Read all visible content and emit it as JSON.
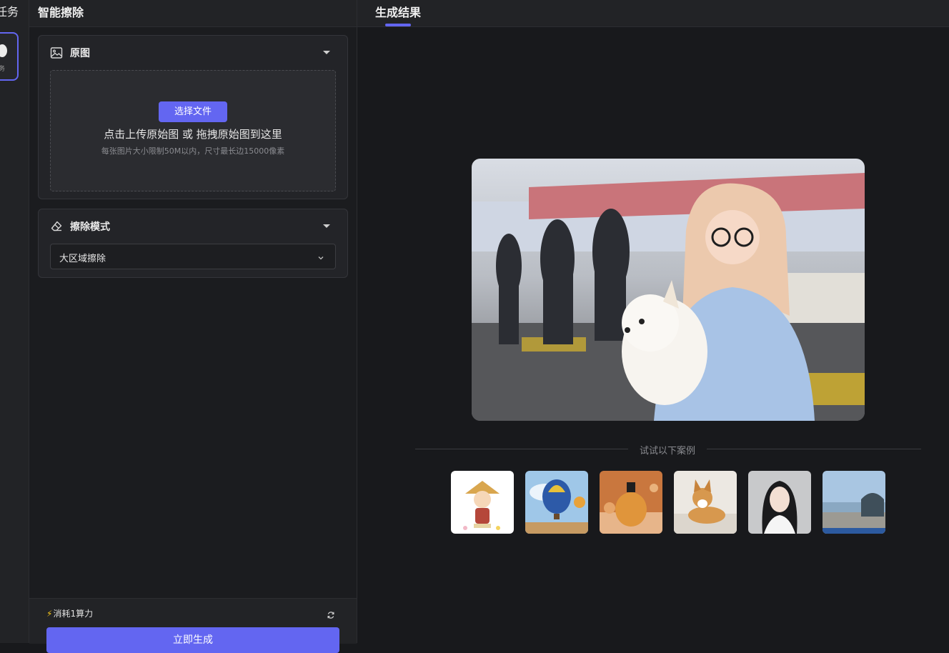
{
  "left_strip": {
    "title_partial": "任务",
    "card_label_partial": "务"
  },
  "panel": {
    "title": "智能擦除",
    "original_section": {
      "label": "原图",
      "select_button": "选择文件",
      "drop_text": "点击上传原始图 或 拖拽原始图到这里",
      "limit_text": "每张图片大小限制50M以内，尺寸最长边15000像素"
    },
    "mode_section": {
      "label": "擦除模式",
      "selected": "大区域擦除"
    },
    "bottom": {
      "cost_icon": "⚡",
      "cost_text": "消耗1算力",
      "generate_button": "立即生成"
    }
  },
  "result": {
    "tab_label": "生成结果",
    "examples_label": "试试以下案例",
    "examples": [
      "anime-boy-straw-hat",
      "hot-air-balloons",
      "perfume-bottle",
      "corgi-dog",
      "portrait-woman",
      "seaside-building"
    ]
  },
  "colors": {
    "accent": "#6366f1",
    "background": "#18191c",
    "panel": "#1b1c1f",
    "bolt": "#f5c518"
  }
}
